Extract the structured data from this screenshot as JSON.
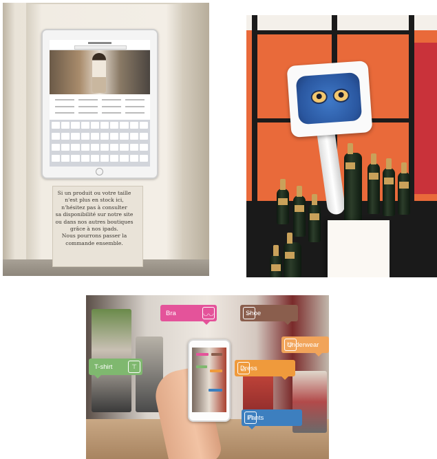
{
  "kiosk": {
    "plaque_lines": [
      "Si un produit ou votre taille",
      "n'est plus en stock ici,",
      "n'hésitez pas à consulter",
      "sa disponibilité sur notre site",
      "ou dans nos autres boutiques",
      "grâce à nos ipads.",
      "Nous pourrons passer la",
      "commande ensemble."
    ]
  },
  "ar_tags": {
    "bra": {
      "label": "Bra",
      "icon": "bra-icon",
      "color": "#e4539a"
    },
    "shoe": {
      "label": "Shoe",
      "icon": "shoe-icon",
      "color": "#8a5e4d"
    },
    "underwear": {
      "label": "Underwear",
      "icon": "underwear-icon",
      "color": "#f1a45a"
    },
    "tshirt": {
      "label": "T-shirt",
      "icon": "tshirt-icon",
      "color": "#7fb86f"
    },
    "dress": {
      "label": "Dress",
      "icon": "dress-icon",
      "color": "#ef9a3c"
    },
    "pants": {
      "label": "Pants",
      "icon": "pants-icon",
      "color": "#3d7fbf"
    }
  }
}
